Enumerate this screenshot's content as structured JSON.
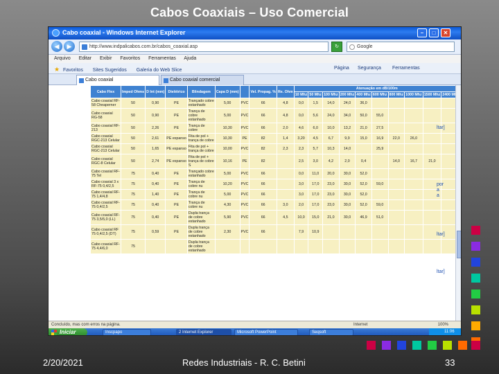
{
  "slide": {
    "title": "Cabos Coaxiais – Uso Comercial",
    "date": "2/20/2021",
    "footer": "Redes Industriais - R. C. Betini",
    "page_number": "33"
  },
  "browser": {
    "window_title": "Cabo coaxial - Windows Internet Explorer",
    "address": "http://www.indpalicabos.com.br/cabos_coaxial.asp",
    "search_text": "Google",
    "menu": [
      "Arquivo",
      "Editar",
      "Exibir",
      "Favoritos",
      "Ferramentas",
      "Ajuda"
    ],
    "favorites_label": "Favoritos",
    "favorites_items": [
      "Sites Sugeridos",
      "Galeria do Web Slice"
    ],
    "right_toolbar": [
      "Página",
      "Segurança",
      "Ferramentas"
    ],
    "tabs": [
      "Cabo coaxial",
      "Cabo coaxial comercial"
    ],
    "status_text": "Concluído, mas com erros na página.",
    "zone": "Internet",
    "zoom": "100%"
  },
  "table": {
    "headers": [
      "Cabo Flex",
      "Imped Ohms",
      "D Int (mm)",
      "Dielétrico",
      "Blindagem",
      "Capa D (mm)",
      "Vel. Propag. %",
      "Re. Ohm",
      "Atenuação em dB/100m"
    ],
    "attenuation_title": "Atenuação em dB/100m",
    "freqs": [
      "10 Mhz",
      "50 Mhz",
      "100 Mhz",
      "200 Mhz",
      "400 Mhz",
      "600 Mhz",
      "800 Mhz",
      "1000 Mhz",
      "1500 Mhz",
      "2400 Mhz"
    ],
    "rows": [
      {
        "name": "Cabo coaxial RF-58 Cheaperner",
        "imp": "50",
        "dint": "0,90",
        "diel": "PE",
        "blind": "Trançado cobre estanhado",
        "capa": "5,00",
        "capa_type": "PVC",
        "vel": "66",
        "re": "4,8",
        "att": [
          "0,0",
          "1,5",
          "14,0",
          "24,0",
          "36,0",
          "",
          "",
          "",
          "",
          ""
        ]
      },
      {
        "name": "Cabo coaxial RG-58",
        "imp": "50",
        "dint": "0,90",
        "diel": "PE",
        "blind": "Trança de cobre estanhado",
        "capa": "5,00",
        "capa_type": "PVC",
        "vel": "66",
        "re": "4,8",
        "att": [
          "0,0",
          "5,6",
          "24,0",
          "34,0",
          "50,0",
          "55,0",
          "",
          "",
          "",
          ""
        ]
      },
      {
        "name": "Cabo coaxial RF-213",
        "imp": "50",
        "dint": "2,26",
        "diel": "PE",
        "blind": "Trança de cobre",
        "capa": "10,30",
        "capa_type": "PVC",
        "vel": "66",
        "re": "2,0",
        "att": [
          "4,6",
          "6,0",
          "10,0",
          "13,2",
          "21,0",
          "27,5",
          "",
          "",
          "",
          ""
        ]
      },
      {
        "name": "Cabo coaxial RGC-213 Celular",
        "imp": "50",
        "dint": "2,61",
        "diel": "PE expanso",
        "blind": "Fita de pol + trança de cobre",
        "capa": "10,30",
        "capa_type": "PE",
        "vel": "82",
        "re": "1,4",
        "att": [
          "3,20",
          "4,5",
          "6,7",
          "9,9",
          "15,0",
          "16,9",
          "22,0",
          "26,0",
          "",
          ""
        ]
      },
      {
        "name": "Cabo coaxial RGC-213 Celular",
        "imp": "50",
        "dint": "1,65",
        "diel": "PE expanso",
        "blind": "Fita de pol + trança de cobre",
        "capa": "10,00",
        "capa_type": "PVC",
        "vel": "82",
        "re": "2,3",
        "att": [
          "2,3",
          "5,7",
          "10,3",
          "14,0",
          "",
          "25,9",
          "",
          "",
          "",
          ""
        ]
      },
      {
        "name": "Cabo coaxial RGC-8 Celular",
        "imp": "50",
        "dint": "2,74",
        "diel": "PE expanso",
        "blind": "Fita de pol + trança de cobre S",
        "capa": "10,16",
        "capa_type": "PE",
        "vel": "82",
        "re": "",
        "att": [
          "2,5",
          "3,0",
          "4,2",
          "2,0",
          "0,4",
          "",
          "14,0",
          "16,7",
          "21,0",
          ""
        ]
      },
      {
        "name": "Cabo coaxial RF-75 Tel",
        "imp": "75",
        "dint": "0,40",
        "diel": "PE",
        "blind": "Trançado cobre estanhado",
        "capa": "5,00",
        "capa_type": "PVC",
        "vel": "66",
        "re": "",
        "att": [
          "0,0",
          "11,0",
          "20,0",
          "30,0",
          "52,0",
          "",
          "",
          "",
          "",
          ""
        ]
      },
      {
        "name": "Cabo coaxial 3 x RF-75 0,4/2,5",
        "imp": "75",
        "dint": "0,40",
        "diel": "PE",
        "blind": "Trança de cobre nu",
        "capa": "10,20",
        "capa_type": "PVC",
        "vel": "66",
        "re": "",
        "att": [
          "3,0",
          "17,0",
          "23,0",
          "30,0",
          "52,0",
          "59,0",
          "",
          "",
          "",
          ""
        ]
      },
      {
        "name": "Cabo coaxial RF-75 1,4/4,8",
        "imp": "75",
        "dint": "1,40",
        "diel": "PE",
        "blind": "Trança de cobre nu",
        "capa": "5,00",
        "capa_type": "PVC",
        "vel": "66",
        "re": "",
        "att": [
          "3,0",
          "17,0",
          "23,0",
          "30,0",
          "52,0",
          "",
          "",
          "",
          "",
          ""
        ]
      },
      {
        "name": "Cabo coaxial RF-75 0,4/2,5",
        "imp": "75",
        "dint": "0,40",
        "diel": "PE",
        "blind": "Trança de cobre nu",
        "capa": "4,30",
        "capa_type": "PVC",
        "vel": "66",
        "re": "3,0",
        "att": [
          "2,0",
          "17,0",
          "23,0",
          "30,0",
          "52,0",
          "59,0",
          "",
          "",
          "",
          ""
        ]
      },
      {
        "name": "Cabo coaxial RF-75 3,5/5,0 (LL)",
        "imp": "75",
        "dint": "0,40",
        "diel": "PE",
        "blind": "Dupla trança de cobre estanhado",
        "capa": "5,90",
        "capa_type": "PVC",
        "vel": "66",
        "re": "4,5",
        "att": [
          "10,0",
          "15,0",
          "21,0",
          "30,0",
          "46,9",
          "51,0",
          "",
          "",
          "",
          ""
        ]
      },
      {
        "name": "Cabo coaxial RF 75 0,4/2,5 (DT)",
        "imp": "75",
        "dint": "0,59",
        "diel": "PE",
        "blind": "Dupla trança de cobre estanhado",
        "capa": "2,30",
        "capa_type": "PVC",
        "vel": "66",
        "re": "",
        "att": [
          "7,9",
          "10,9",
          "",
          "",
          "",
          "",
          "",
          "",
          "",
          ""
        ]
      },
      {
        "name": "Cabo coaxial RF-75 4,4/6,0",
        "imp": "75",
        "dint": "",
        "diel": "",
        "blind": "Dupla trança de cobre estanhado",
        "capa": "",
        "capa_type": "",
        "vel": "",
        "re": "",
        "att": [
          "",
          "",
          "",
          "",
          "",
          "",
          "",
          "",
          "",
          ""
        ]
      }
    ]
  },
  "taskbar": {
    "start_label": "Iniciar",
    "items": [
      "Inscpapo",
      "2 Internet Explorer",
      "Microsoft PowerPoint",
      "Seqsoft"
    ],
    "clock": "11:06"
  },
  "side_snippets": [
    "ltar]",
    "por",
    "a",
    "a",
    "ltar]",
    "ltar]"
  ],
  "colors": {
    "header_blue": "#3f82d1",
    "cell_yellow": "#f7f0c2",
    "ie_blue": "#0a58d8"
  }
}
